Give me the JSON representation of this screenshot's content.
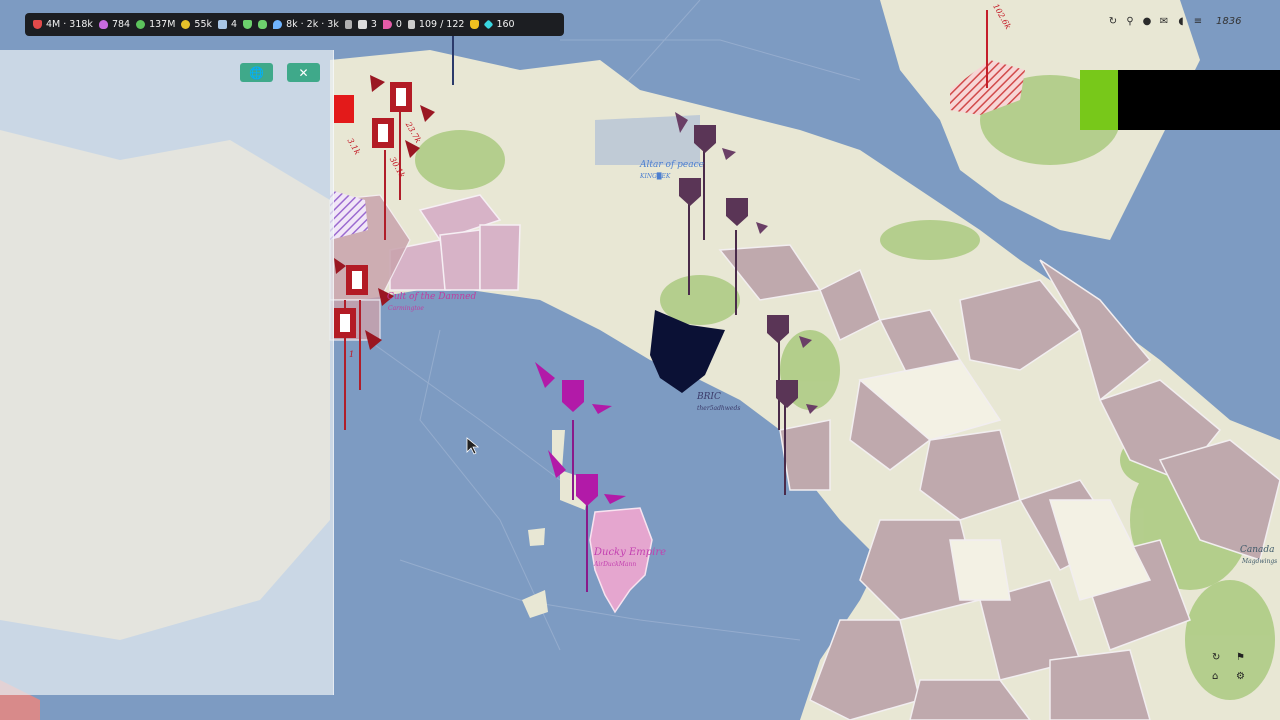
{
  "topbar": {
    "stats": [
      {
        "icon": "shield-icon",
        "color": "#e24a4a",
        "text": "4M · 318k"
      },
      {
        "icon": "flame-icon",
        "color": "#c86be0",
        "text": "784"
      },
      {
        "icon": "money-bag-icon",
        "color": "#5cc35c",
        "text": "137M"
      },
      {
        "icon": "coins-icon",
        "color": "#e6c12a",
        "text": "55k"
      },
      {
        "icon": "robot-icon",
        "color": "#a9c6e6",
        "text": "4"
      },
      {
        "icon": "emblem-icon",
        "color": "#6dd26d",
        "text": ""
      },
      {
        "icon": "chat-icon",
        "color": "#6dd26d",
        "text": ""
      },
      {
        "icon": "pin-icon",
        "color": "#6fb4ff",
        "text": "8k · 2k · 3k"
      },
      {
        "icon": "tools-icon",
        "color": "#b0b0b0",
        "text": ""
      },
      {
        "icon": "message-icon",
        "color": "#dddddd",
        "text": "3"
      },
      {
        "icon": "horn-icon",
        "color": "#e45ca8",
        "text": "0"
      },
      {
        "icon": "units-icon",
        "color": "#cccccc",
        "text": "109 / 122"
      },
      {
        "icon": "trophy-icon",
        "color": "#f0c020",
        "text": ""
      },
      {
        "icon": "gem-icon",
        "color": "#39d6e0",
        "text": "160"
      }
    ]
  },
  "panel": {
    "globe_symbol": "🌐",
    "close_symbol": "✕"
  },
  "right_tools": {
    "year": "1836"
  },
  "map_labels": [
    {
      "text": "Cult of the Damned",
      "sub": "Carmingtoe",
      "color": "#c03da0"
    },
    {
      "text": "Altar of peace",
      "sub": "KING█EK",
      "color": "#4c7fd0"
    },
    {
      "text": "BRIC",
      "sub": "ther5adhweds",
      "color": "#3a3a6a"
    },
    {
      "text": "Ducky Empire",
      "sub": "AirDuckMann",
      "color": "#c340b0"
    },
    {
      "text": "Canada",
      "sub": "Magdwings",
      "color": "#3f5a6a"
    }
  ],
  "army_labels": [
    "3.1k",
    "23.7k",
    "30.1k",
    "102.6k",
    "1"
  ],
  "colors": {
    "sea": "#7d9bc2",
    "land": "#e8e7d4",
    "terrain_green": "#9bc46e",
    "ui_green": "#3fa98a"
  }
}
